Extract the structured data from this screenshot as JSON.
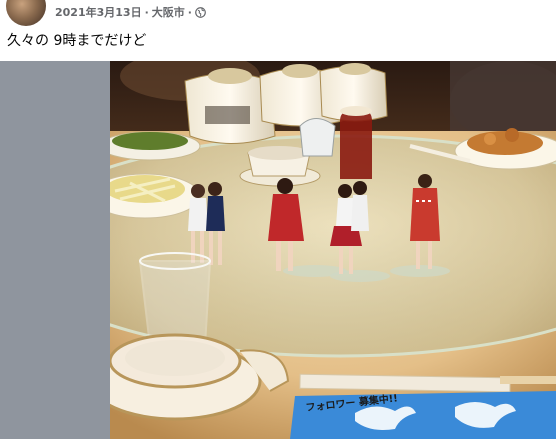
{
  "post": {
    "date": "2021年3月13日",
    "separator": "·",
    "location": "大阪市",
    "privacy_icon": "globe-icon",
    "text": "久々の 9時までだけど"
  },
  "photo": {
    "type": "photo",
    "placemat_text": "フォロワー 募集中!!"
  },
  "colors": {
    "meta_text": "#65676b",
    "body_text": "#050505",
    "photo_background": "#8f959e"
  }
}
